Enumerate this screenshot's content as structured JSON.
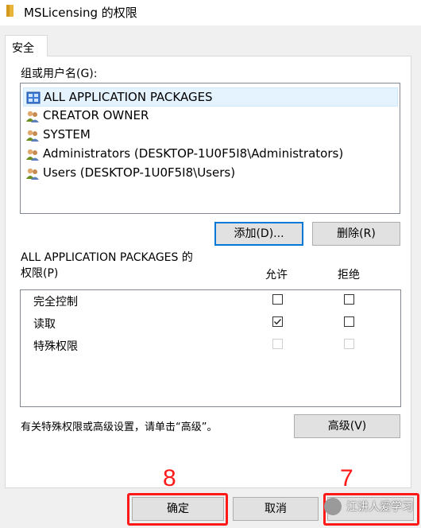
{
  "window": {
    "title": "MSLicensing 的权限",
    "icon": "folder-icon"
  },
  "tab": {
    "label": "安全"
  },
  "groups": {
    "label": "组或用户名(G):",
    "items": [
      {
        "name": "ALL APPLICATION PACKAGES",
        "icon": "app-packages-icon",
        "selected": true
      },
      {
        "name": "CREATOR OWNER",
        "icon": "users-icon"
      },
      {
        "name": "SYSTEM",
        "icon": "users-icon"
      },
      {
        "name": "Administrators (DESKTOP-1U0F5I8\\Administrators)",
        "icon": "users-icon"
      },
      {
        "name": "Users (DESKTOP-1U0F5I8\\Users)",
        "icon": "users-icon"
      }
    ]
  },
  "buttons": {
    "add": "添加(D)...",
    "remove": "删除(R)",
    "advanced": "高级(V)",
    "ok": "确定",
    "cancel": "取消"
  },
  "permissions": {
    "title_line1": "ALL APPLICATION PACKAGES 的",
    "title_line2": "权限(P)",
    "allow_header": "允许",
    "deny_header": "拒绝",
    "rows": [
      {
        "label": "完全控制",
        "allow": false,
        "deny": false,
        "enabled": true
      },
      {
        "label": "读取",
        "allow": true,
        "deny": false,
        "enabled": true
      },
      {
        "label": "特殊权限",
        "allow": false,
        "deny": false,
        "enabled": false
      }
    ]
  },
  "info_text": "有关特殊权限或高级设置，请单击“高级”。",
  "annotations": {
    "ok_step": "8",
    "apply_step": "7"
  },
  "watermark": {
    "text": "江讲人爱学习"
  },
  "colors": {
    "highlight": "#ff1a1a",
    "focus": "#0078d7",
    "selection": "#e5f3ff"
  }
}
